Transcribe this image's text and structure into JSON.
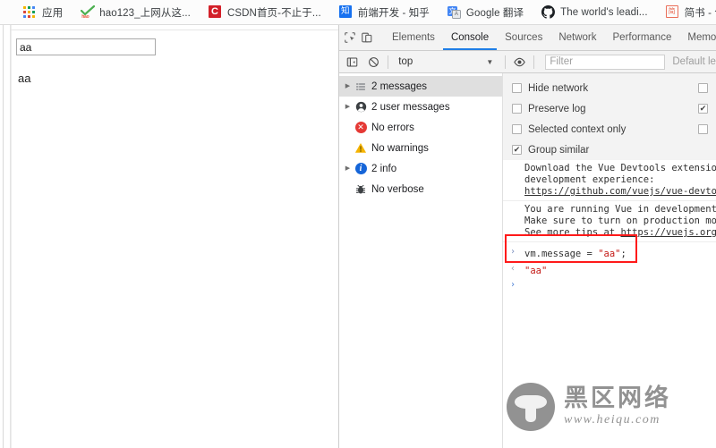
{
  "bookmarks": [
    {
      "label": "应用",
      "icon": "apps-grid-icon"
    },
    {
      "label": "hao123_上网从这...",
      "icon": "hao123-icon"
    },
    {
      "label": "CSDN首页-不止于...",
      "icon": "csdn-icon"
    },
    {
      "label": "前端开发 - 知乎",
      "icon": "zhihu-icon"
    },
    {
      "label": "Google 翻译",
      "icon": "google-translate-icon"
    },
    {
      "label": "The world's leadi...",
      "icon": "github-icon"
    },
    {
      "label": "简书 - 创作你的创...",
      "icon": "jianshu-icon"
    }
  ],
  "page": {
    "input_value": "aa",
    "input_placeholder": "",
    "message_text": "aa"
  },
  "devtools": {
    "inspect_icon": "inspect-element-icon",
    "device_icon": "device-toolbar-icon",
    "tabs": [
      {
        "label": "Elements",
        "active": false
      },
      {
        "label": "Console",
        "active": true
      },
      {
        "label": "Sources",
        "active": false
      },
      {
        "label": "Network",
        "active": false
      },
      {
        "label": "Performance",
        "active": false
      },
      {
        "label": "Memo",
        "active": false
      }
    ],
    "toolbar": {
      "sidebar_toggle_icon": "show-console-sidebar-icon",
      "clear_icon": "clear-console-icon",
      "context": "top",
      "context_caret": "▼",
      "eye_icon": "live-expression-icon",
      "filter_placeholder": "Filter",
      "levels_label": "Default le"
    },
    "sidebar": [
      {
        "label": "2 messages",
        "icon": "list-icon",
        "expandable": true,
        "selected": true
      },
      {
        "label": "2 user messages",
        "icon": "user-icon",
        "expandable": true,
        "selected": false
      },
      {
        "label": "No errors",
        "icon": "error-icon",
        "expandable": false,
        "selected": false
      },
      {
        "label": "No warnings",
        "icon": "warning-icon",
        "expandable": false,
        "selected": false
      },
      {
        "label": "2 info",
        "icon": "info-icon",
        "expandable": true,
        "selected": false
      },
      {
        "label": "No verbose",
        "icon": "verbose-bug-icon",
        "expandable": false,
        "selected": false
      }
    ],
    "options": [
      {
        "label": "Hide network",
        "checked": false
      },
      {
        "label": "Preserve log",
        "checked": false
      },
      {
        "label": "Selected context only",
        "checked": false
      },
      {
        "label": "Group similar",
        "checked": true
      }
    ],
    "options_right": [
      {
        "label": "",
        "checked": false
      },
      {
        "label": "",
        "checked": true
      },
      {
        "label": "",
        "checked": false
      }
    ],
    "log": {
      "vue_devtools": {
        "line1": "Download the Vue Devtools extension fo",
        "line2": "development experience:",
        "link": "https://github.com/vuejs/vue-devtools"
      },
      "vue_dev_mode": {
        "line1": "You are running Vue in development mod",
        "line2": "Make sure to turn on production mode w",
        "line3_prefix": "See more tips at ",
        "line3_link": "https://vuejs.org/gui"
      },
      "command": {
        "arrow": "›",
        "prefix": "vm.message = ",
        "value": "\"aa\"",
        "suffix": ";"
      },
      "result": {
        "arrow": "‹",
        "value": "\"aa\""
      },
      "empty_prompt_arrow": "›"
    }
  },
  "watermark": {
    "cn_text": "黑区网络",
    "url_text": "www.heiqu.com",
    "logo_icon": "mushroom-logo-icon"
  }
}
